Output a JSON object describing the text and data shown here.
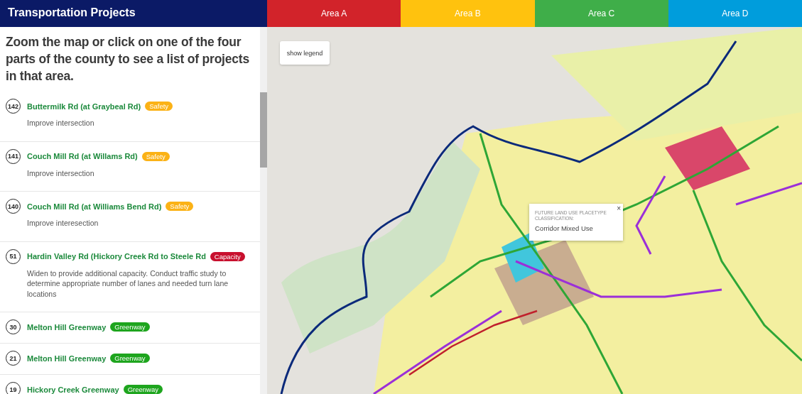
{
  "sidebar": {
    "title": "Transportation Projects",
    "intro": "Zoom the map or click on one of the four parts of the county to see a list of projects in that area.",
    "projects": [
      {
        "number": "142",
        "name": "Buttermilk Rd (at Graybeal Rd)",
        "tag": {
          "label": "Safety",
          "color": "#fbb216"
        },
        "description": "Improve intersection"
      },
      {
        "number": "141",
        "name": "Couch Mill Rd (at Willams Rd)",
        "tag": {
          "label": "Safety",
          "color": "#fbb216"
        },
        "description": "Improve intersection"
      },
      {
        "number": "140",
        "name": "Couch Mill Rd (at Williams Bend Rd)",
        "tag": {
          "label": "Safety",
          "color": "#fbb216"
        },
        "description": "Improve interesection"
      },
      {
        "number": "51",
        "name": "Hardin Valley Rd (Hickory Creek Rd to Steele Rd",
        "tag": {
          "label": "Capacity",
          "color": "#c8102e"
        },
        "description": "Widen to provide additional capacity. Conduct traffic study to determine appropriate number of lanes and needed turn lane locations"
      },
      {
        "number": "30",
        "name": "Melton Hill Greenway",
        "tag": {
          "label": "Greenway",
          "color": "#1ea51e"
        }
      },
      {
        "number": "21",
        "name": "Melton Hill Greenway",
        "tag": {
          "label": "Greenway",
          "color": "#1ea51e"
        }
      },
      {
        "number": "19",
        "name": "Hickory Creek Greenway",
        "tag": {
          "label": "Greenway",
          "color": "#1ea51e"
        }
      }
    ]
  },
  "area_tabs": [
    {
      "label": "Area A",
      "color": "#d2232a"
    },
    {
      "label": "Area B",
      "color": "#ffc20e"
    },
    {
      "label": "Area C",
      "color": "#3fae49"
    },
    {
      "label": "Area D",
      "color": "#009ddc"
    }
  ],
  "map": {
    "legend_button": "show legend",
    "popup": {
      "heading": "FUTURE LAND USE PLACETYPE CLASSIFICATION:",
      "value": "Corridor Mixed Use",
      "close": "×"
    }
  }
}
